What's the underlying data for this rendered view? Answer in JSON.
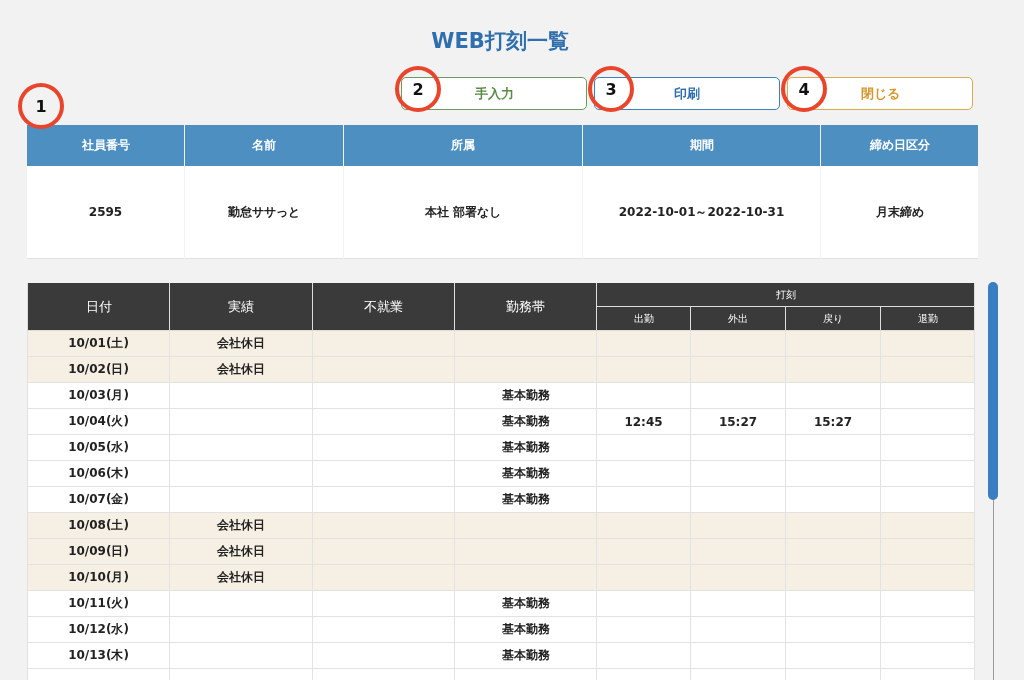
{
  "title": "WEB打刻一覧",
  "callouts": [
    {
      "label": "1"
    },
    {
      "label": "2"
    },
    {
      "label": "3"
    },
    {
      "label": "4"
    }
  ],
  "buttons": [
    {
      "label": "手入力",
      "kind": "input"
    },
    {
      "label": "印刷",
      "kind": "print"
    },
    {
      "label": "閉じる",
      "kind": "close"
    }
  ],
  "info": {
    "columns": [
      "社員番号",
      "名前",
      "所属",
      "期間",
      "締め日区分"
    ],
    "values": [
      "2595",
      "勤怠ササっと",
      "本社 部署なし",
      "2022-10-01～2022-10-31",
      "月末締め"
    ]
  },
  "table": {
    "columns": [
      "日付",
      "実績",
      "不就業",
      "勤務帯"
    ],
    "group": "打刻",
    "subcolumns": [
      "出勤",
      "外出",
      "戻り",
      "退勤"
    ],
    "rows": [
      {
        "date": "10/01(土)",
        "result": "会社休日",
        "holiday": true
      },
      {
        "date": "10/02(日)",
        "result": "会社休日",
        "holiday": true
      },
      {
        "date": "10/03(月)",
        "shift": "基本勤務",
        "holiday": false
      },
      {
        "date": "10/04(火)",
        "shift": "基本勤務",
        "clock_in": "12:45",
        "go_out": "15:27",
        "return": "15:27",
        "holiday": false
      },
      {
        "date": "10/05(水)",
        "shift": "基本勤務",
        "holiday": false
      },
      {
        "date": "10/06(木)",
        "shift": "基本勤務",
        "holiday": false
      },
      {
        "date": "10/07(金)",
        "shift": "基本勤務",
        "holiday": false
      },
      {
        "date": "10/08(土)",
        "result": "会社休日",
        "holiday": true
      },
      {
        "date": "10/09(日)",
        "result": "会社休日",
        "holiday": true
      },
      {
        "date": "10/10(月)",
        "result": "会社休日",
        "holiday": true
      },
      {
        "date": "10/11(火)",
        "shift": "基本勤務",
        "holiday": false
      },
      {
        "date": "10/12(水)",
        "shift": "基本勤務",
        "holiday": false
      },
      {
        "date": "10/13(木)",
        "shift": "基本勤務",
        "holiday": false
      }
    ]
  }
}
